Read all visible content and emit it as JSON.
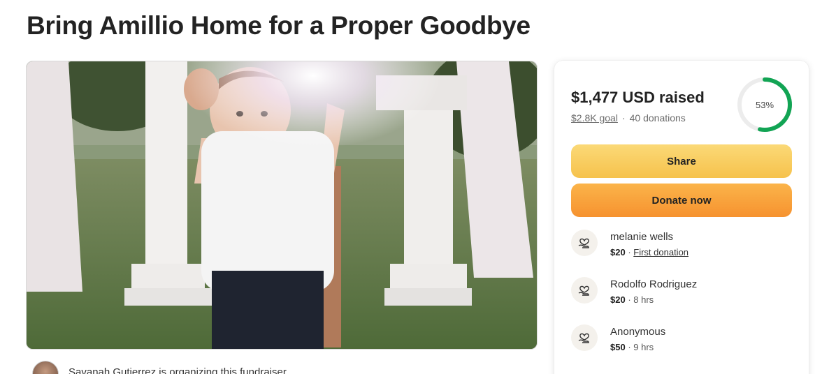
{
  "page": {
    "title": "Bring Amillio Home for a Proper Goodbye"
  },
  "organizer": {
    "text": "Savanah Gutierrez is organizing this fundraiser."
  },
  "summary": {
    "raised": "$1,477 USD raised",
    "goal": "$2.8K goal",
    "separator": "·",
    "donations_count": "40 donations",
    "progress_label": "53%",
    "progress": 0.53,
    "progress_color": "#12a454"
  },
  "buttons": {
    "share": "Share",
    "donate": "Donate now"
  },
  "donations": [
    {
      "name": "melanie wells",
      "amount": "$20",
      "sep": " · ",
      "meta": "First donation",
      "meta_is_link": true
    },
    {
      "name": "Rodolfo Rodriguez",
      "amount": "$20",
      "sep": " · ",
      "meta": "8 hrs",
      "meta_is_link": false
    },
    {
      "name": "Anonymous",
      "amount": "$50",
      "sep": " · ",
      "meta": "9 hrs",
      "meta_is_link": false
    }
  ],
  "icons": {
    "donor": "heart-hand-icon"
  }
}
